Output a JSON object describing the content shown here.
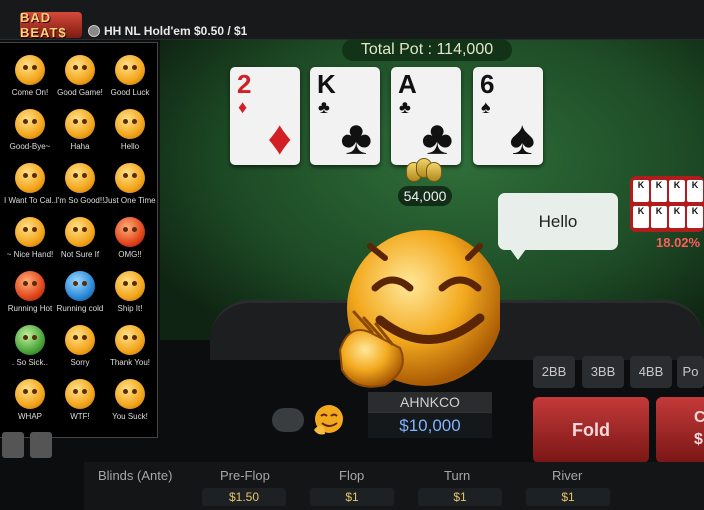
{
  "header": {
    "logo_text": "BAD BEAT$",
    "game_title": "HH NL Hold'em $0.50 / $1"
  },
  "table": {
    "total_pot": "Total Pot : 114,000",
    "board": [
      {
        "rank": "2",
        "suit": "♦",
        "color": "#d21f26"
      },
      {
        "rank": "K",
        "suit": "♣",
        "color": "#111111"
      },
      {
        "rank": "A",
        "suit": "♣",
        "color": "#111111"
      },
      {
        "rank": "6",
        "suit": "♠",
        "color": "#111111"
      }
    ],
    "pot_chips": "54,000",
    "speech_bubble": "Hello",
    "opponent_cards": [
      "K",
      "K",
      "K",
      "K",
      "K",
      "K",
      "K",
      "K"
    ],
    "opponent_percent": "18.02%"
  },
  "player": {
    "name": "AHNKCO",
    "stack": "$10,000"
  },
  "bet_buttons": [
    "2BB",
    "3BB",
    "4BB",
    "Po"
  ],
  "actions": {
    "fold": "Fold",
    "second_partial": "C $"
  },
  "blinds": {
    "labels": [
      "Blinds (Ante)",
      "Pre-Flop",
      "Flop",
      "Turn",
      "River"
    ],
    "values": [
      "$1.50",
      "$1",
      "$1",
      "$1"
    ]
  },
  "emoji_panel": {
    "items": [
      {
        "label": "Come On!",
        "tone": "yellow"
      },
      {
        "label": "Good Game!",
        "tone": "yellow"
      },
      {
        "label": "Good Luck",
        "tone": "yellow"
      },
      {
        "label": "Good-Bye~",
        "tone": "yellow"
      },
      {
        "label": "Haha",
        "tone": "yellow"
      },
      {
        "label": "Hello",
        "tone": "yellow"
      },
      {
        "label": "I Want To Cal..",
        "tone": "yellow"
      },
      {
        "label": "I'm So Good!!",
        "tone": "yellow"
      },
      {
        "label": "Just One Time!",
        "tone": "yellow"
      },
      {
        "label": "~ Nice Hand!",
        "tone": "yellow"
      },
      {
        "label": "Not Sure If",
        "tone": "yellow"
      },
      {
        "label": "OMG!!",
        "tone": "red"
      },
      {
        "label": "Running Hot",
        "tone": "red"
      },
      {
        "label": "Running cold",
        "tone": "blue"
      },
      {
        "label": "Ship It!",
        "tone": "yellow"
      },
      {
        "label": ". So Sick..",
        "tone": "green"
      },
      {
        "label": "Sorry",
        "tone": "yellow"
      },
      {
        "label": "Thank You!",
        "tone": "yellow"
      },
      {
        "label": "WHAP",
        "tone": "yellow"
      },
      {
        "label": "WTF!",
        "tone": "yellow"
      },
      {
        "label": "You Suck!",
        "tone": "yellow"
      }
    ]
  },
  "colors": {
    "felt": "#2f6f3a",
    "fold_button": "#c33a39",
    "stack_text": "#7fb2ff",
    "blind_values": "#e5c36b"
  }
}
